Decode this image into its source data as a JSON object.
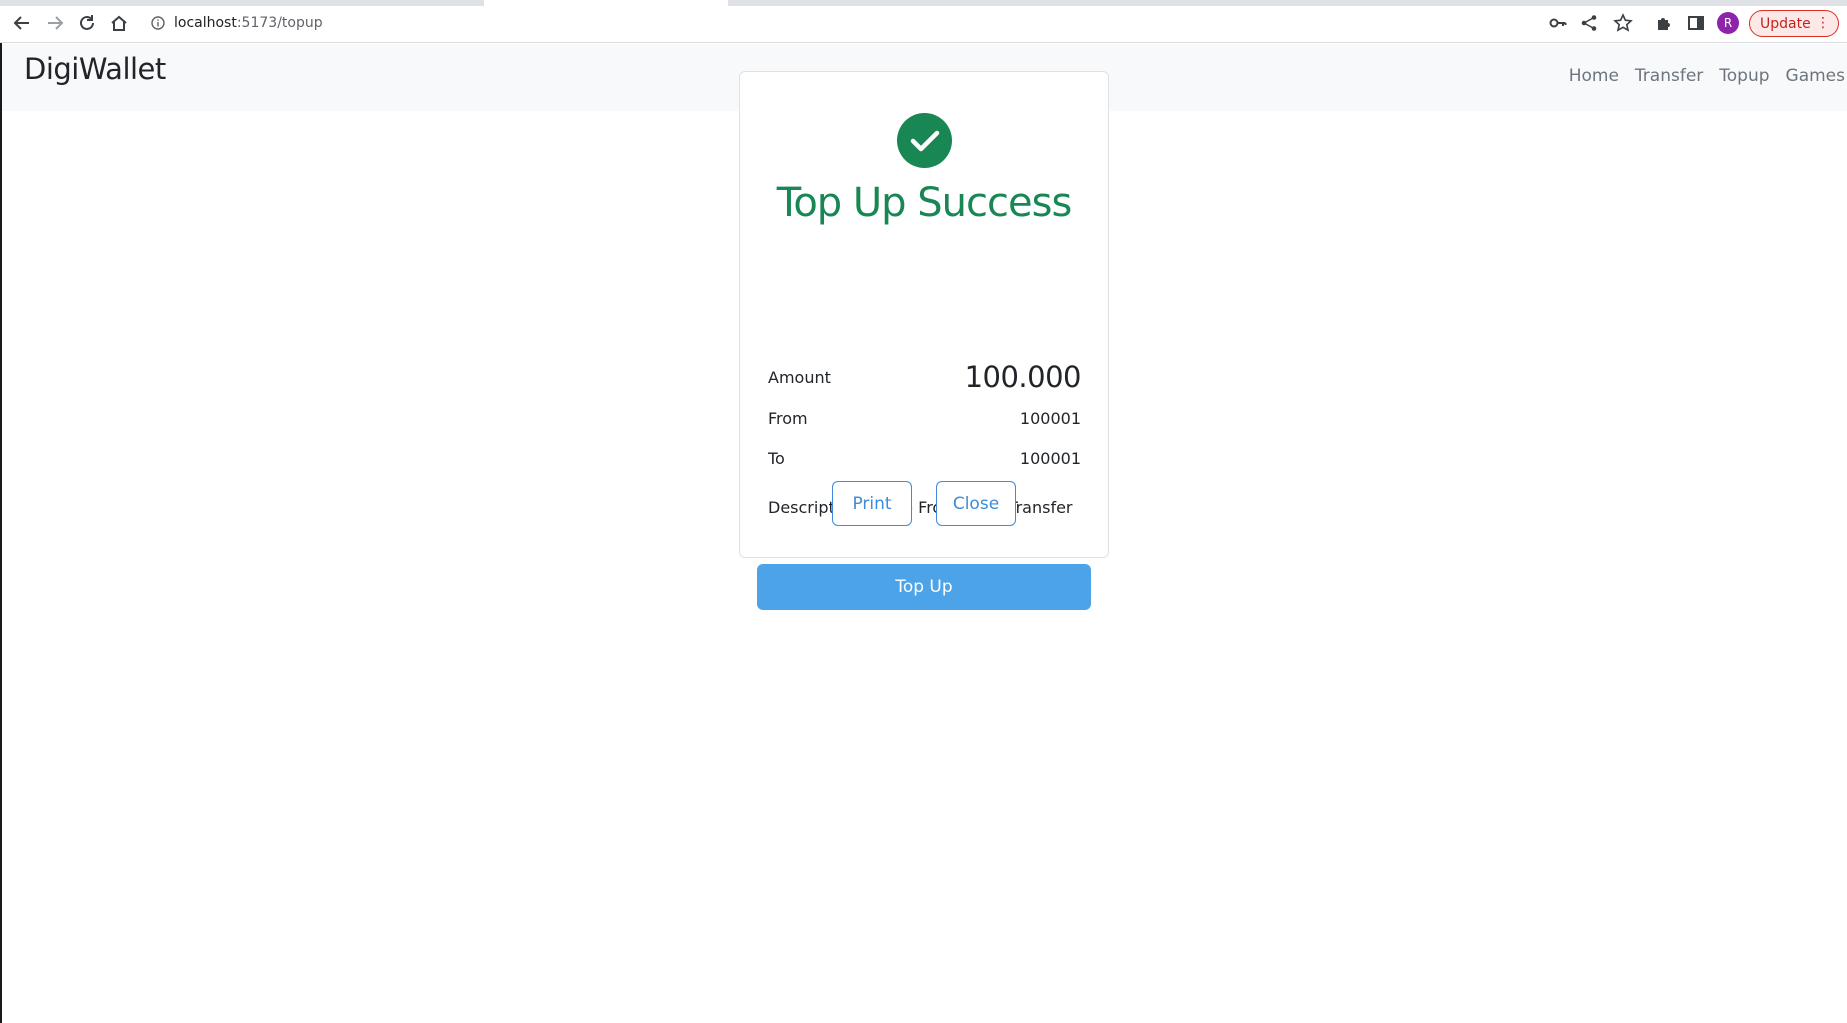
{
  "browser": {
    "url_host": "localhost",
    "url_path": ":5173/topup",
    "profile_initial": "R",
    "update_label": "Update"
  },
  "app": {
    "brand": "DigiWallet",
    "nav": [
      "Home",
      "Transfer",
      "Topup",
      "Games"
    ]
  },
  "modal": {
    "title": "Top Up Success",
    "amount_label": "Amount",
    "amount_value": "100.000",
    "from_label": "From",
    "from_value": "100001",
    "to_label": "To",
    "to_value": "100001",
    "description_label": "Description",
    "description_value": "Top Up From Bank Transfer",
    "print_label": "Print",
    "close_label": "Close"
  },
  "form": {
    "submit_label": "Top Up"
  },
  "colors": {
    "success": "#198754",
    "primary_outline": "#3d8bd9",
    "topup_button": "#4da3e8"
  }
}
